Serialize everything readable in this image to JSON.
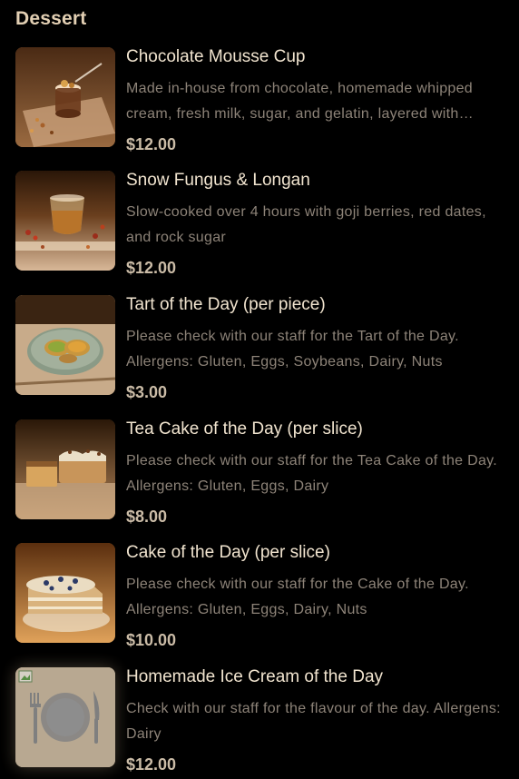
{
  "section": {
    "title": "Dessert"
  },
  "items": [
    {
      "name": "Chocolate Mousse Cup",
      "description": "Made in-house from chocolate, homemade whipped cream, fresh milk, sugar, and gelatin, layered with…",
      "price": "$12.00",
      "image": "chocolate-mousse-photo"
    },
    {
      "name": "Snow Fungus & Longan",
      "description": "Slow-cooked over 4 hours with goji berries, red dates, and rock sugar",
      "price": "$12.00",
      "image": "snow-fungus-photo"
    },
    {
      "name": "Tart of the Day (per piece)",
      "description": "Please check with our staff for the Tart of the Day. Allergens: Gluten, Eggs, Soybeans, Dairy, Nuts",
      "price": "$3.00",
      "image": "tart-photo"
    },
    {
      "name": "Tea Cake of the Day (per slice)",
      "description": "Please check with our staff for the Tea Cake of the Day. Allergens: Gluten, Eggs, Dairy",
      "price": "$8.00",
      "image": "tea-cake-photo"
    },
    {
      "name": "Cake of the Day (per slice)",
      "description": "Please check with our staff for the Cake of the Day. Allergens: Gluten, Eggs, Dairy, Nuts",
      "price": "$10.00",
      "image": "cake-photo"
    },
    {
      "name": "Homemade Ice Cream of the Day",
      "description": "Check with our staff for the flavour of the day. Allergens: Dairy",
      "price": "$12.00",
      "image": "plate-fork-knife-placeholder-icon"
    }
  ],
  "colors": {
    "background": "#000000",
    "title": "#e2cfb3",
    "name": "#f1e4cf",
    "description": "#8d8378",
    "price": "#cbbca7"
  }
}
